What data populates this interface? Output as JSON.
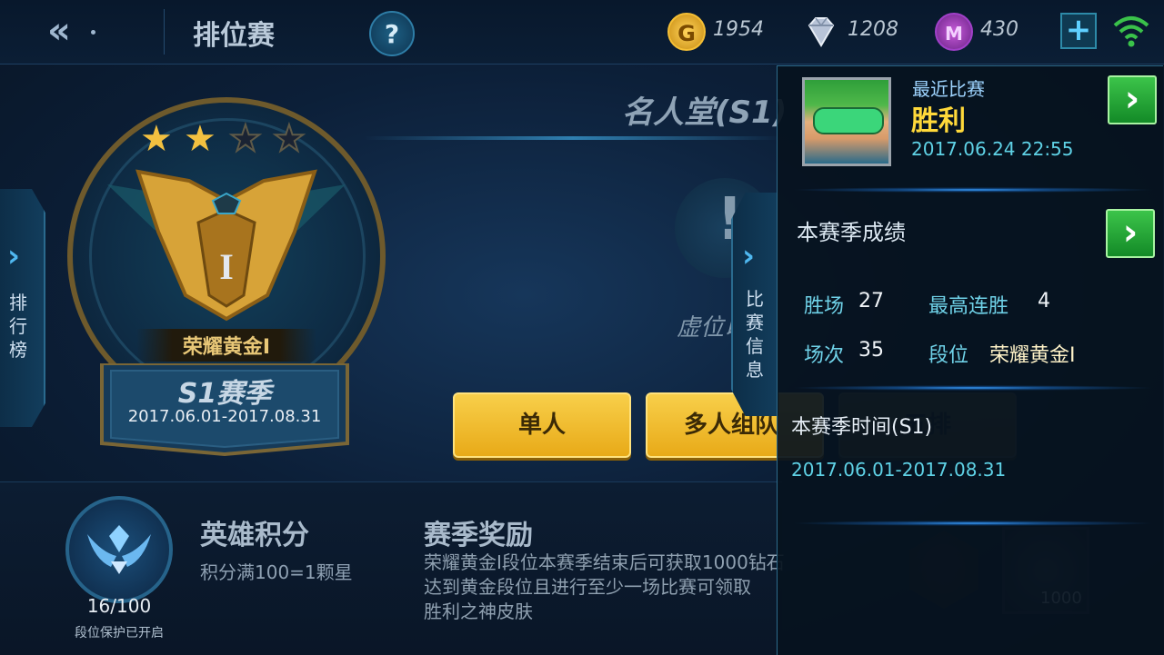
{
  "topbar": {
    "title": "排位赛",
    "help": "?",
    "gold": "1954",
    "gold_icon_letter": "G",
    "diamond": "1208",
    "m_currency": "430",
    "m_icon_letter": "M",
    "plus": "+",
    "icons": [
      "back-icon",
      "help-icon",
      "gold-coin-icon",
      "diamond-icon",
      "m-coin-icon",
      "plus-icon",
      "wifi-icon"
    ]
  },
  "left_tab": {
    "arrow": "›",
    "label": "排行榜"
  },
  "badge": {
    "stars_filled": 2,
    "stars_total": 4,
    "tier_numeral": "I",
    "tier_name": "荣耀黄金I",
    "season_name": "S1赛季",
    "season_dates": "2017.06.01-2017.08.31",
    "colors": {
      "gold": "#f2c040",
      "empty_star": "#1a2333"
    }
  },
  "hall_of_fame": {
    "title": "名人堂(S1)",
    "status": "虚位以待"
  },
  "info_tab": {
    "arrow": "›",
    "label": "比赛信息"
  },
  "modes": [
    {
      "label": "单人"
    },
    {
      "label": "多人组队"
    },
    {
      "label": "五排"
    }
  ],
  "hero_score": {
    "title": "英雄积分",
    "desc": "积分满100=1颗星",
    "value": "16/100",
    "progress": 0.16,
    "protect": "段位保护已开启"
  },
  "season_reward": {
    "title": "赛季奖励",
    "desc_lines": [
      "荣耀黄金I段位本赛季结束后可获取1000钻石",
      "达到黄金段位且进行至少一场比赛可领取",
      "胜利之神皮肤"
    ],
    "item_count": "1000"
  },
  "right_panel": {
    "recent_label": "最近比赛",
    "recent_result": "胜利",
    "recent_time": "2017.06.24 22:55",
    "arrow": "›",
    "season_record_title": "本赛季成绩",
    "stats": {
      "wins_label": "胜场",
      "wins": "27",
      "streak_label": "最高连胜",
      "streak": "4",
      "matches_label": "场次",
      "matches": "35",
      "tier_label": "段位",
      "tier": "荣耀黄金I"
    },
    "season_time_title": "本赛季时间(S1)",
    "season_time": "2017.06.01-2017.08.31"
  }
}
